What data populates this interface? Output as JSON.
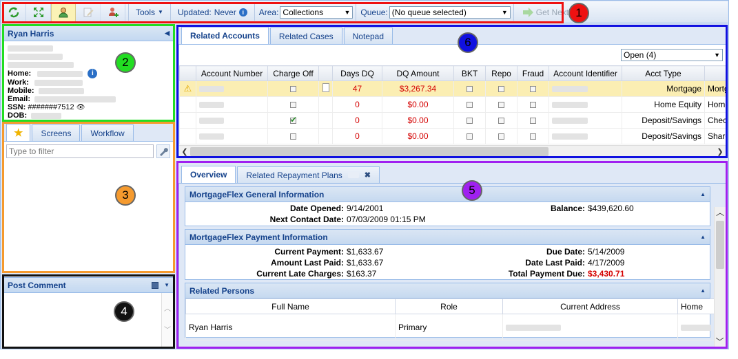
{
  "toolbar": {
    "tools_label": "Tools",
    "updated_label": "Updated:",
    "updated_value": "Never",
    "area_label": "Area:",
    "area_value": "Collections",
    "queue_label": "Queue:",
    "queue_value": "(No queue selected)",
    "get_next_label": "Get Next"
  },
  "customer": {
    "name": "Ryan Harris",
    "home_label": "Home:",
    "work_label": "Work:",
    "mobile_label": "Mobile:",
    "email_label": "Email:",
    "ssn_label": "SSN:",
    "ssn_value": "#######7512",
    "dob_label": "DOB:"
  },
  "left_tabs": {
    "screens": "Screens",
    "workflow": "Workflow",
    "filter_placeholder": "Type to filter"
  },
  "post_comment": {
    "title": "Post Comment"
  },
  "accounts_tabs": {
    "related_accounts": "Related Accounts",
    "related_cases": "Related Cases",
    "notepad": "Notepad"
  },
  "accounts_filter": "Open (4)",
  "accounts_grid": {
    "columns": [
      "Account Number",
      "Charge Off",
      "Days DQ",
      "DQ Amount",
      "BKT",
      "Repo",
      "Fraud",
      "Account Identifier",
      "Acct Type"
    ],
    "rows": [
      {
        "days_dq": "47",
        "dq_amount": "$3,267.34",
        "acct_type": "Mortgage",
        "next": "Mortg",
        "charge_off": false,
        "warning": true
      },
      {
        "days_dq": "0",
        "dq_amount": "$0.00",
        "acct_type": "Home Equity",
        "next": "Home",
        "charge_off": false,
        "warning": false
      },
      {
        "days_dq": "0",
        "dq_amount": "$0.00",
        "acct_type": "Deposit/Savings",
        "next": "Chec",
        "charge_off": true,
        "warning": false
      },
      {
        "days_dq": "0",
        "dq_amount": "$0.00",
        "acct_type": "Deposit/Savings",
        "next": "Share",
        "charge_off": false,
        "warning": false
      }
    ]
  },
  "detail_tabs": {
    "overview": "Overview",
    "repayment": "Related Repayment Plans"
  },
  "general": {
    "title": "MortgageFlex General Information",
    "date_opened_label": "Date Opened:",
    "date_opened": "9/14/2001",
    "next_contact_label": "Next Contact Date:",
    "next_contact": "07/03/2009 01:15 PM",
    "balance_label": "Balance:",
    "balance": "$439,620.60"
  },
  "payment": {
    "title": "MortgageFlex Payment Information",
    "current_payment_label": "Current Payment:",
    "current_payment": "$1,633.67",
    "amount_last_paid_label": "Amount Last Paid:",
    "amount_last_paid": "$1,633.67",
    "late_charges_label": "Current Late Charges:",
    "late_charges": "$163.37",
    "due_date_label": "Due Date:",
    "due_date": "5/14/2009",
    "date_last_paid_label": "Date Last Paid:",
    "date_last_paid": "4/17/2009",
    "total_due_label": "Total Payment Due:",
    "total_due": "$3,430.71"
  },
  "persons": {
    "title": "Related Persons",
    "columns": [
      "Full Name",
      "Role",
      "Current Address",
      "Home"
    ],
    "rows": [
      {
        "name": "Ryan Harris",
        "role": "Primary"
      }
    ]
  },
  "callouts": [
    "1",
    "2",
    "3",
    "4",
    "5",
    "6"
  ],
  "colors": {
    "callout_1": "#ee1111",
    "callout_2": "#22dd22",
    "callout_3": "#f59a2e",
    "callout_4": "#111111",
    "callout_5": "#a020f0",
    "callout_6": "#1010e0"
  }
}
